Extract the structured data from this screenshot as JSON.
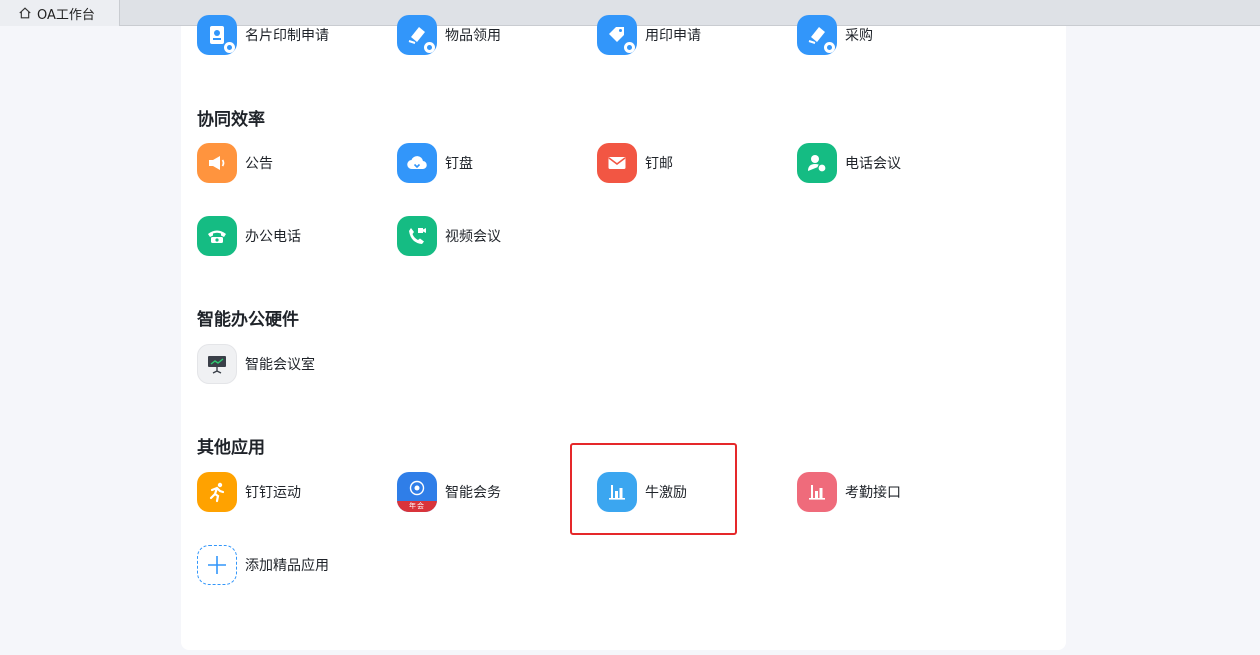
{
  "tab": {
    "title": "OA工作台",
    "icon": "home-icon"
  },
  "sections": [
    {
      "title": "协同效率"
    },
    {
      "title": "智能办公硬件"
    },
    {
      "title": "其他应用"
    }
  ],
  "apps": {
    "business_card": {
      "label": "名片印制申请",
      "icon": "business-card-icon",
      "color": "#3296fa"
    },
    "item_request": {
      "label": "物品领用",
      "icon": "box-icon",
      "color": "#3296fa"
    },
    "seal_request": {
      "label": "用印申请",
      "icon": "seal-icon",
      "color": "#3296fa"
    },
    "purchase": {
      "label": "采购",
      "icon": "purchase-icon",
      "color": "#3296fa"
    },
    "announcement": {
      "label": "公告",
      "icon": "megaphone-icon",
      "color": "#ff943e"
    },
    "ding_disk": {
      "label": "钉盘",
      "icon": "cloud-icon",
      "color": "#3296fa"
    },
    "ding_mail": {
      "label": "钉邮",
      "icon": "mail-icon",
      "color": "#f25643"
    },
    "phone_meeting": {
      "label": "电话会议",
      "icon": "phone-meeting-icon",
      "color": "#15bc83"
    },
    "office_phone": {
      "label": "办公电话",
      "icon": "telephone-icon",
      "color": "#15bc83"
    },
    "video_meeting": {
      "label": "视频会议",
      "icon": "video-call-icon",
      "color": "#15bc83"
    },
    "smart_room": {
      "label": "智能会议室",
      "icon": "presentation-screen-icon",
      "color": "#f0f1f3"
    },
    "ding_sport": {
      "label": "钉钉运动",
      "icon": "running-icon",
      "color": "#ffa200"
    },
    "smart_affairs": {
      "label": "智能会务",
      "icon": "conference-icon",
      "color": "#2f7ee8",
      "ribbon": "年会"
    },
    "niu_incentive": {
      "label": "牛激励",
      "icon": "bar-chart-icon",
      "color": "#3ba6f0"
    },
    "attendance_api": {
      "label": "考勤接口",
      "icon": "bar-chart-icon",
      "color": "#ef6b7b"
    },
    "add_app": {
      "label": "添加精品应用",
      "icon": "plus-icon",
      "color": "#3296fa"
    }
  }
}
